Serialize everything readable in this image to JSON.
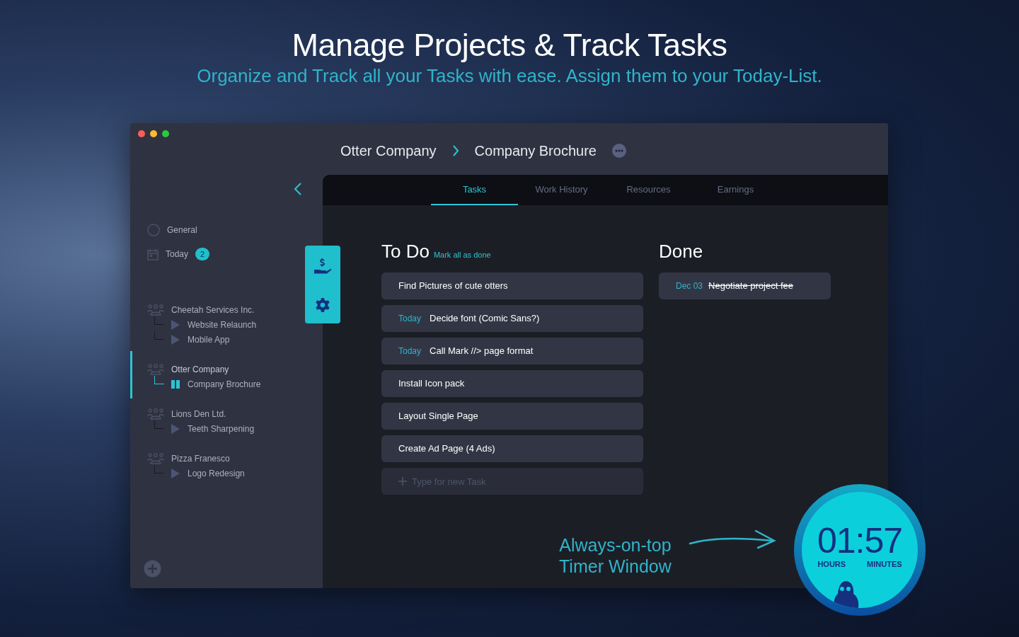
{
  "header": {
    "title": "Manage Projects & Track Tasks",
    "subtitle": "Organize and Track all your Tasks with ease. Assign them to your Today-List."
  },
  "window": {
    "breadcrumb": [
      "Otter Company",
      "Company Brochure"
    ]
  },
  "sidebar": {
    "items": [
      {
        "kind": "general",
        "label": "General"
      },
      {
        "kind": "today",
        "label": "Today",
        "badge": "2"
      }
    ],
    "clients": [
      {
        "name": "Cheetah Services Inc.",
        "selected": false,
        "projects": [
          {
            "name": "Website Relaunch",
            "running": false
          },
          {
            "name": "Mobile App",
            "running": false
          }
        ]
      },
      {
        "name": "Otter Company",
        "selected": true,
        "projects": [
          {
            "name": "Company Brochure",
            "running": true
          }
        ]
      },
      {
        "name": "Lions Den Ltd.",
        "selected": false,
        "projects": [
          {
            "name": "Teeth Sharpening",
            "running": false
          }
        ]
      },
      {
        "name": "Pizza Franesco",
        "selected": false,
        "projects": [
          {
            "name": "Logo Redesign",
            "running": false
          }
        ]
      }
    ]
  },
  "tabs": [
    {
      "label": "Tasks",
      "selected": true
    },
    {
      "label": "Work History",
      "selected": false
    },
    {
      "label": "Resources",
      "selected": false
    },
    {
      "label": "Earnings",
      "selected": false
    }
  ],
  "todo": {
    "title": "To Do",
    "action": "Mark all as done",
    "tasks": [
      {
        "label": "Find Pictures of cute otters"
      },
      {
        "tag": "Today",
        "label": "Decide font (Comic Sans?)"
      },
      {
        "tag": "Today",
        "label": "Call Mark //> page format"
      },
      {
        "label": "Install Icon pack"
      },
      {
        "label": "Layout Single Page"
      },
      {
        "label": "Create Ad Page (4 Ads)"
      }
    ],
    "new_task": {
      "placeholder": "Type for new Task"
    }
  },
  "done": {
    "title": "Done",
    "tasks": [
      {
        "date": "Dec 03",
        "label": "Negotiate project fee"
      }
    ]
  },
  "annotation": [
    "Always-on-top",
    "Timer Window"
  ],
  "timer": {
    "time": "01:57",
    "hours_label": "HOURS",
    "minutes_label": "MINUTES"
  }
}
